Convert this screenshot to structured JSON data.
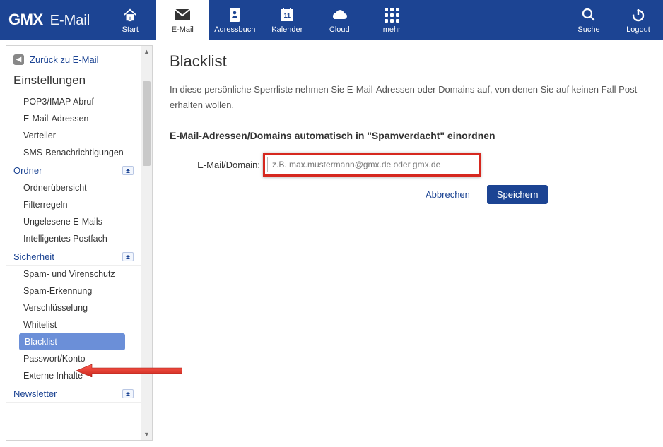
{
  "brand": {
    "logo": "GMX",
    "product": "E-Mail"
  },
  "nav": {
    "items": [
      {
        "id": "start",
        "label": "Start"
      },
      {
        "id": "email",
        "label": "E-Mail"
      },
      {
        "id": "addressbook",
        "label": "Adressbuch"
      },
      {
        "id": "calendar",
        "label": "Kalender",
        "day": "11"
      },
      {
        "id": "cloud",
        "label": "Cloud"
      },
      {
        "id": "more",
        "label": "mehr"
      }
    ],
    "right": [
      {
        "id": "search",
        "label": "Suche"
      },
      {
        "id": "logout",
        "label": "Logout"
      }
    ],
    "active": "email"
  },
  "sidebar": {
    "back_label": "Zurück zu E-Mail",
    "title": "Einstellungen",
    "groups": [
      {
        "id": "general",
        "label": "",
        "items": [
          {
            "id": "pop3",
            "label": "POP3/IMAP Abruf"
          },
          {
            "id": "addresses",
            "label": "E-Mail-Adressen"
          },
          {
            "id": "verteiler",
            "label": "Verteiler"
          },
          {
            "id": "sms",
            "label": "SMS-Benachrichtigungen"
          }
        ]
      },
      {
        "id": "ordner",
        "label": "Ordner",
        "items": [
          {
            "id": "overview",
            "label": "Ordnerübersicht"
          },
          {
            "id": "filter",
            "label": "Filterregeln"
          },
          {
            "id": "unread",
            "label": "Ungelesene E-Mails"
          },
          {
            "id": "smart",
            "label": "Intelligentes Postfach"
          }
        ]
      },
      {
        "id": "security",
        "label": "Sicherheit",
        "items": [
          {
            "id": "spamvirus",
            "label": "Spam- und Virenschutz"
          },
          {
            "id": "spamdetect",
            "label": "Spam-Erkennung"
          },
          {
            "id": "encrypt",
            "label": "Verschlüsselung"
          },
          {
            "id": "whitelist",
            "label": "Whitelist"
          },
          {
            "id": "blacklist",
            "label": "Blacklist",
            "selected": true
          },
          {
            "id": "password",
            "label": "Passwort/Konto"
          },
          {
            "id": "external",
            "label": "Externe Inhalte"
          }
        ]
      },
      {
        "id": "newsletter",
        "label": "Newsletter",
        "items": []
      }
    ]
  },
  "main": {
    "title": "Blacklist",
    "description": "In diese persönliche Sperrliste nehmen Sie E-Mail-Adressen oder Domains auf, von denen Sie auf keinen Fall Post erhalten wollen.",
    "section_heading": "E-Mail-Adressen/Domains automatisch in \"Spamverdacht\" einordnen",
    "field_label": "E-Mail/Domain:",
    "placeholder": "z.B. max.mustermann@gmx.de oder gmx.de",
    "cancel": "Abbrechen",
    "save": "Speichern"
  }
}
